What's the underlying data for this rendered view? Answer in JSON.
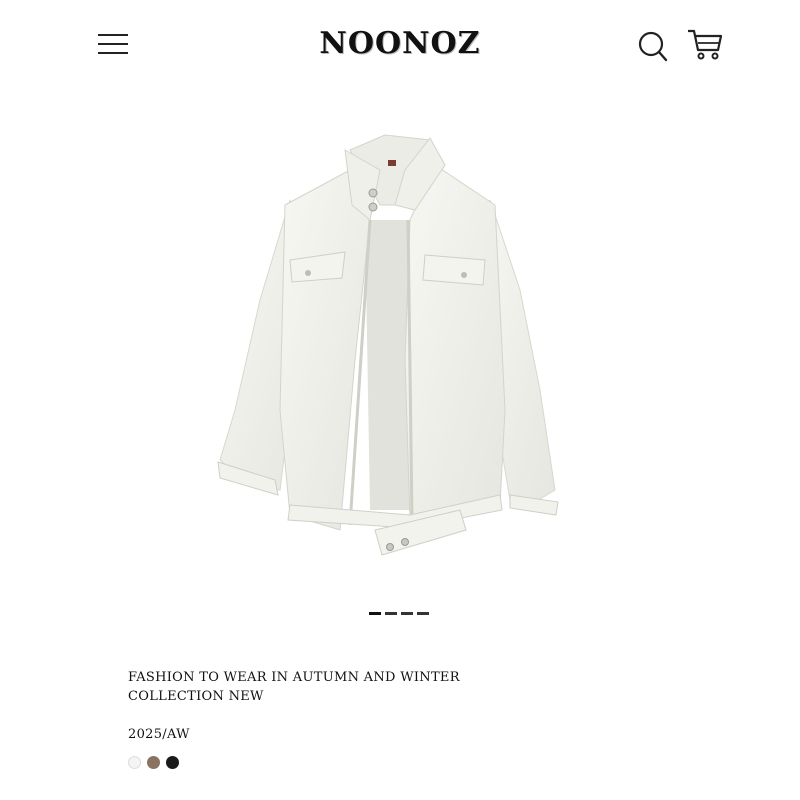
{
  "header": {
    "brand": "NOONOZ",
    "menu_icon": "hamburger-menu-icon",
    "search_icon": "search-icon",
    "cart_icon": "shopping-cart-icon"
  },
  "product": {
    "image_icon": "white-jacket-product-image",
    "title_line1": "FASHION TO WEAR IN AUTUMN AND WINTER",
    "title_line2": "COLLECTION NEW",
    "season": "2025/AW",
    "color_swatches": [
      "#f4f4f2",
      "#8b7362",
      "#1a1a1a"
    ]
  },
  "carousel": {
    "slide_count": 4,
    "active_index": 0
  }
}
